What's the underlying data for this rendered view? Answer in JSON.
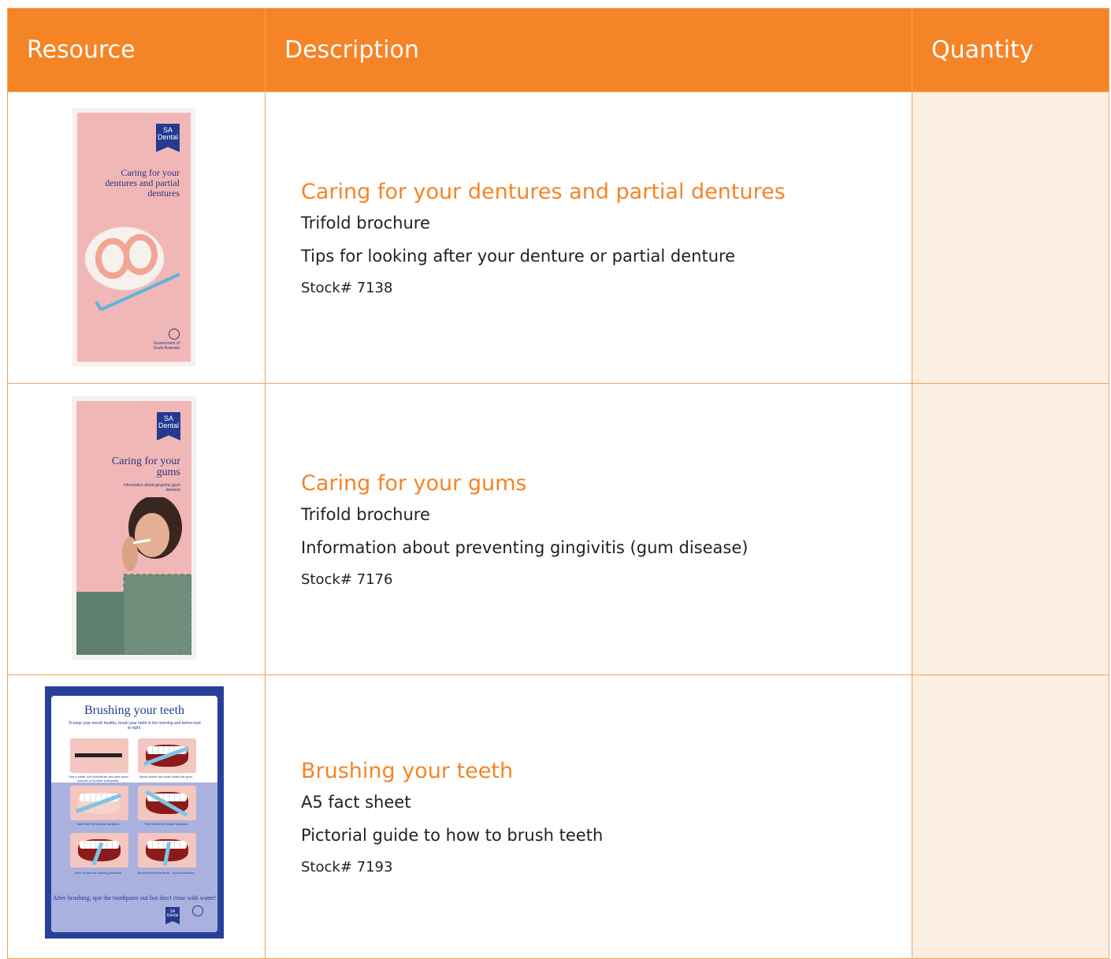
{
  "table": {
    "headers": [
      "Resource",
      "Description",
      "Quantity"
    ],
    "rows": [
      {
        "title": "Caring for your dentures and partial dentures",
        "type": "Trifold brochure",
        "description": "Tips for looking after your denture or partial denture",
        "stock": "Stock# 7138",
        "thumb": {
          "logo": "SA Dental",
          "title": "Caring for your dentures and partial dentures",
          "gov": "Government of South Australia"
        }
      },
      {
        "title": "Caring for your gums",
        "type": "Trifold brochure",
        "description": "Information about preventing gingivitis (gum disease)",
        "stock": "Stock# 7176",
        "thumb": {
          "logo": "SA Dental",
          "title": "Caring for your gums",
          "subtitle": "Information about gingivitis (gum disease)"
        }
      },
      {
        "title": "Brushing your teeth",
        "type": "A5 fact sheet",
        "description": "Pictorial guide to how to brush teeth",
        "stock": "Stock# 7193",
        "thumb": {
          "title": "Brushing your teeth",
          "subtitle": "To keep your mouth healthy, brush your teeth in the morning and before bed at night.",
          "captions": [
            "Use a small, soft toothbrush and pea sized amount of fluoride toothpaste.",
            "Brush where the tooth meets the gum.",
            "Start with the outside surfaces.",
            "Then brush the inside surfaces.",
            "Next, brush the chewing surfaces.",
            "Brush behind the teeth – top and bottom."
          ],
          "footer": "After brushing, spit the toothpaste out but don't rinse with water!",
          "logo": "SA Dental"
        }
      }
    ]
  },
  "colors": {
    "accent": "#f58426",
    "quantity_fill": "#fdeee2",
    "brand_blue": "#243a8f"
  }
}
